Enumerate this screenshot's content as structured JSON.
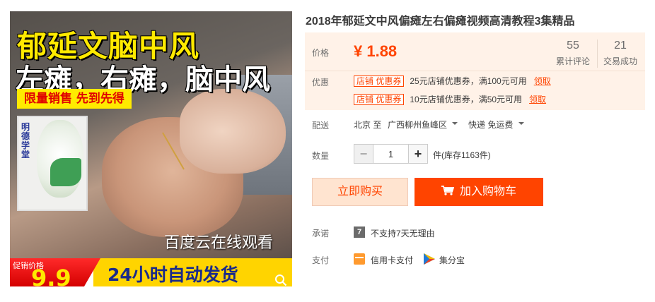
{
  "product": {
    "title": "2018年郁延文中风偏瘫左右偏瘫视频高清教程3集精品",
    "image": {
      "headline_1": "郁延文脑中风",
      "headline_2": "左瘫，右瘫，脑中风",
      "limited_badge": "限量销售 先到先得",
      "bag_text": "明德学堂",
      "caption": "百度云在线观看",
      "promo_label": "促销价格",
      "promo_price": "9.9",
      "promo_banner": "24小时自动发货"
    }
  },
  "price": {
    "label": "价格",
    "value": "¥ 1.88",
    "reviews_count": "55",
    "reviews_label": "累计评论",
    "sales_count": "21",
    "sales_label": "交易成功"
  },
  "coupons": {
    "label": "优惠",
    "items": [
      {
        "tag": "店铺 优惠券",
        "desc": "25元店铺优惠券，满100元可用",
        "action": "领取"
      },
      {
        "tag": "店铺 优惠券",
        "desc": "10元店铺优惠券，满50元可用",
        "action": "领取"
      }
    ]
  },
  "shipping": {
    "label": "配送",
    "from": "北京 至",
    "to": "广西柳州鱼峰区",
    "method": "快递 免运费"
  },
  "quantity": {
    "label": "数量",
    "value": "1",
    "minus": "−",
    "plus": "+",
    "stock": "件(库存1163件)"
  },
  "actions": {
    "buy_now": "立即购买",
    "add_to_cart": "加入购物车"
  },
  "promise": {
    "label": "承诺",
    "badge": "7",
    "text": "不支持7天无理由"
  },
  "payment": {
    "label": "支付",
    "methods": [
      {
        "name": "信用卡支付",
        "icon": "credit-card-icon"
      },
      {
        "name": "集分宝",
        "icon": "jifenbao-icon"
      }
    ]
  },
  "colors": {
    "accent": "#ff4400",
    "price_panel_bg": "#fff2e8",
    "buy_now_bg": "#ffe4d0"
  }
}
